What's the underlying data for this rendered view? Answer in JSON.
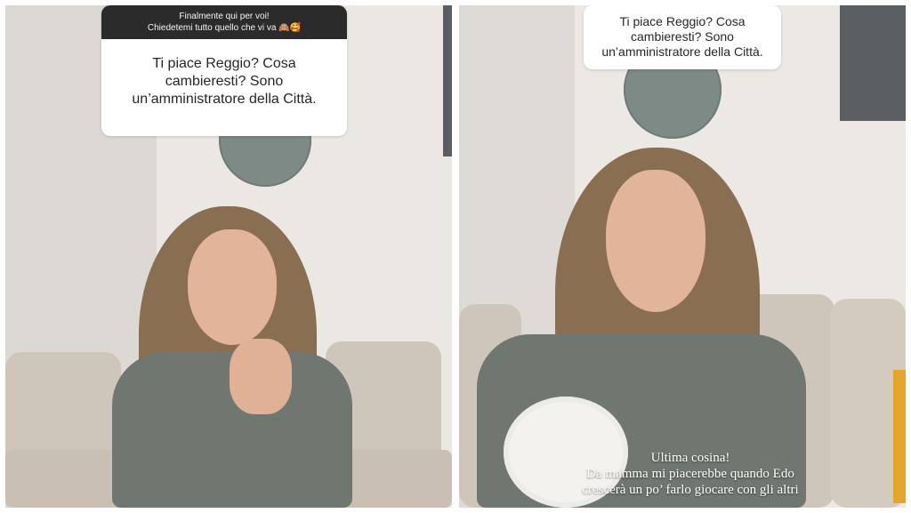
{
  "left_panel": {
    "question_header_line1": "Finalmente qui per voi!",
    "question_header_line2": "Chiedetemi tutto quello che vi va 🙈🥰",
    "question_text": "Ti piace Reggio? Cosa cambieresti? Sono un’amministratore della Città."
  },
  "right_panel": {
    "question_text": "Ti piace Reggio? Cosa cambieresti? Sono un’amministratore della Città.",
    "caption_line1": "Ultima cosina!",
    "caption_line2": "Da mamma mi piacerebbe quando Edo",
    "caption_line3": "crescerà un po’ farlo giocare con gli altri"
  },
  "colors": {
    "question_header_bg": "#2b2b2b",
    "question_card_bg": "#ffffff",
    "sofa": "#cfc6bb",
    "clock": "#7d8a86"
  }
}
